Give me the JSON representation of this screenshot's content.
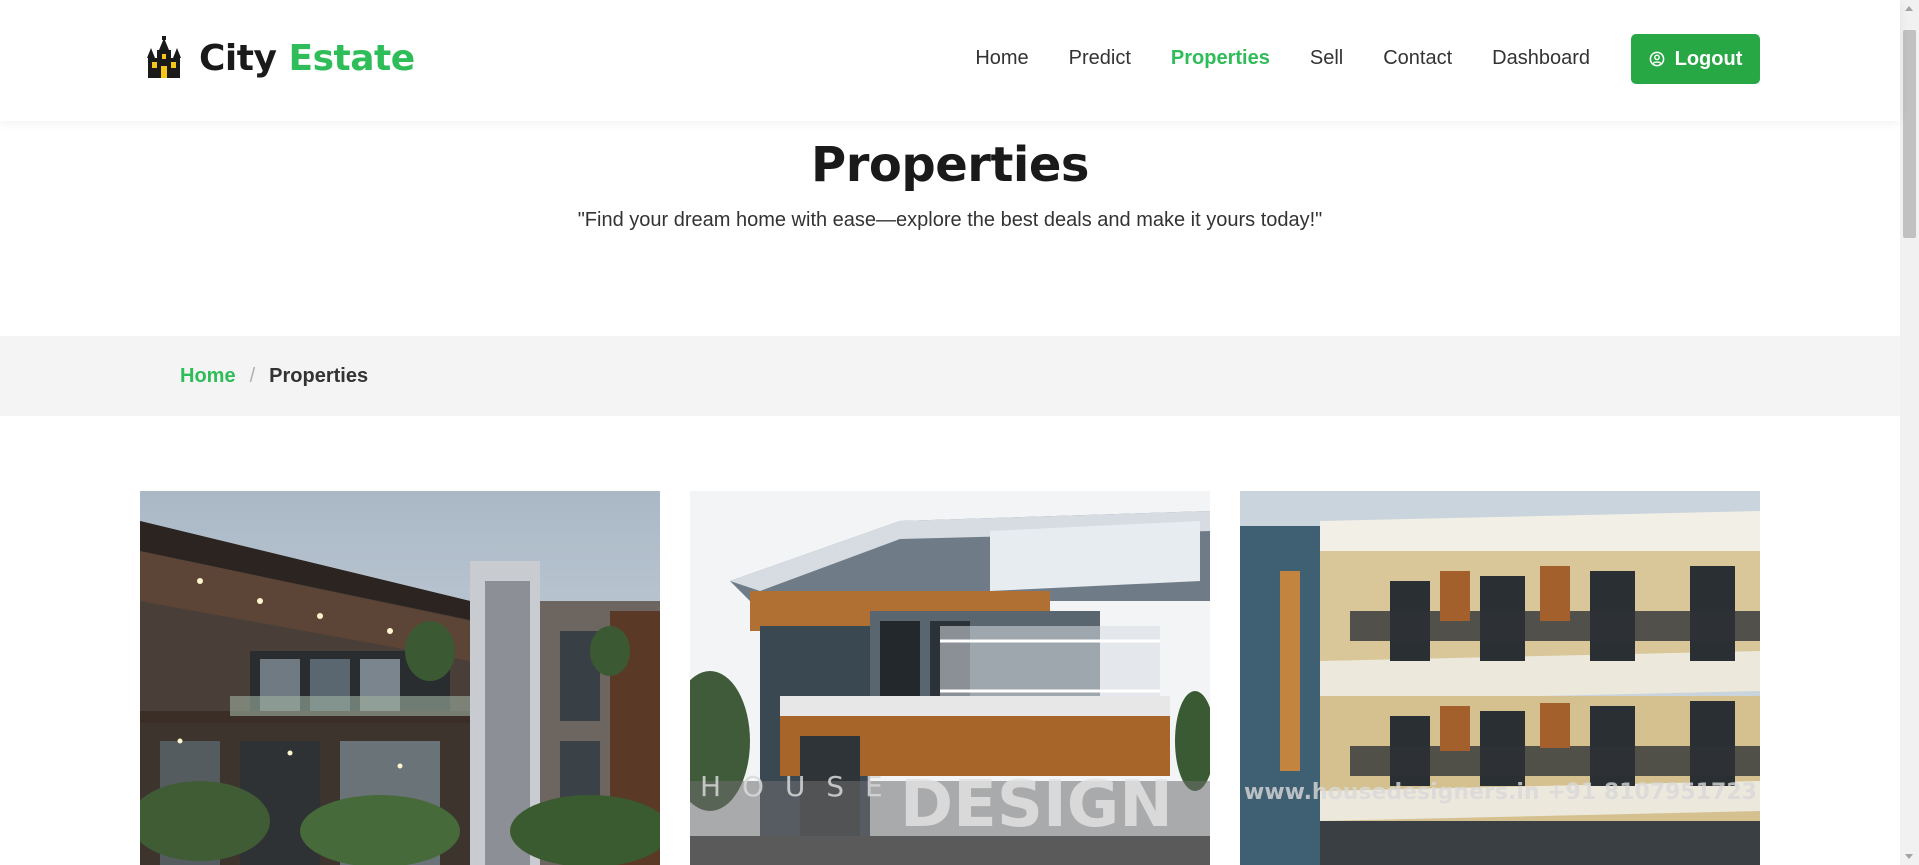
{
  "brand": {
    "name_part1": "City",
    "name_part2": "Estate",
    "logo_icon": "haunted-house-icon"
  },
  "nav": {
    "items": [
      {
        "label": "Home",
        "active": false
      },
      {
        "label": "Predict",
        "active": false
      },
      {
        "label": "Properties",
        "active": true
      },
      {
        "label": "Sell",
        "active": false
      },
      {
        "label": "Contact",
        "active": false
      },
      {
        "label": "Dashboard",
        "active": false
      }
    ],
    "logout_label": "Logout",
    "logout_icon": "user-circle-icon"
  },
  "header": {
    "title": "Properties",
    "tagline": "\"Find your dream home with ease—explore the best deals and make it yours today!\""
  },
  "breadcrumb": {
    "home": "Home",
    "separator": "/",
    "current": "Properties"
  },
  "cards": {
    "card2_watermark": "DESIGN",
    "card2_watermark_small": "H O U S E",
    "card3_watermark": "www.housedesigners.in     +91 8107951723"
  },
  "colors": {
    "accent": "#2ebd59",
    "button": "#28a745",
    "breadcrumb_bg": "#f4f4f4"
  }
}
